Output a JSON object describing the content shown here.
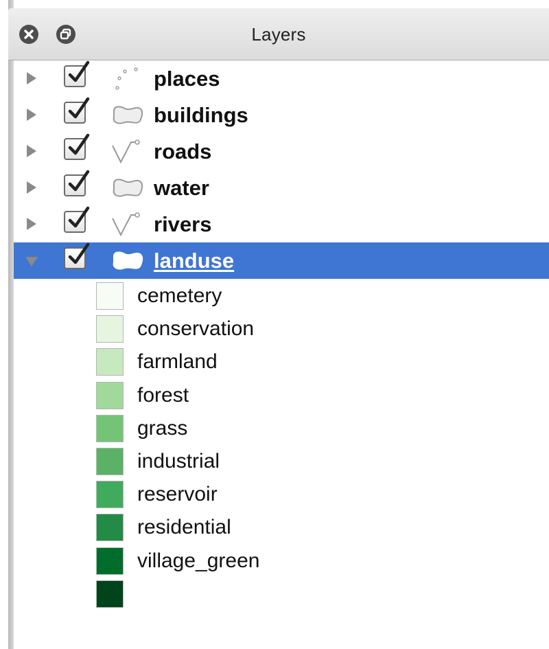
{
  "panel": {
    "title": "Layers",
    "close_icon": "close-icon",
    "float_icon": "float-icon"
  },
  "layers": [
    {
      "name": "places",
      "checked": true,
      "geometry": "point",
      "expanded": false,
      "selected": false
    },
    {
      "name": "buildings",
      "checked": true,
      "geometry": "polygon",
      "expanded": false,
      "selected": false
    },
    {
      "name": "roads",
      "checked": true,
      "geometry": "line",
      "expanded": false,
      "selected": false
    },
    {
      "name": "water",
      "checked": true,
      "geometry": "polygon",
      "expanded": false,
      "selected": false
    },
    {
      "name": "rivers",
      "checked": true,
      "geometry": "line",
      "expanded": false,
      "selected": false
    },
    {
      "name": "landuse",
      "checked": true,
      "geometry": "polygon",
      "expanded": true,
      "selected": true
    }
  ],
  "legend": [
    {
      "label": "cemetery",
      "color": "#f7fcf5"
    },
    {
      "label": "conservation",
      "color": "#e5f5e0"
    },
    {
      "label": "farmland",
      "color": "#c7e9c0"
    },
    {
      "label": "forest",
      "color": "#a1d99b"
    },
    {
      "label": "grass",
      "color": "#74c476"
    },
    {
      "label": "industrial",
      "color": "#5bb266"
    },
    {
      "label": "reservoir",
      "color": "#41ab5d"
    },
    {
      "label": "residential",
      "color": "#238b45"
    },
    {
      "label": "village_green",
      "color": "#006d2c"
    },
    {
      "label": "",
      "color": "#00441b"
    }
  ],
  "colors": {
    "selection": "#3f76d3",
    "titlebar": "#e6e6e6"
  }
}
